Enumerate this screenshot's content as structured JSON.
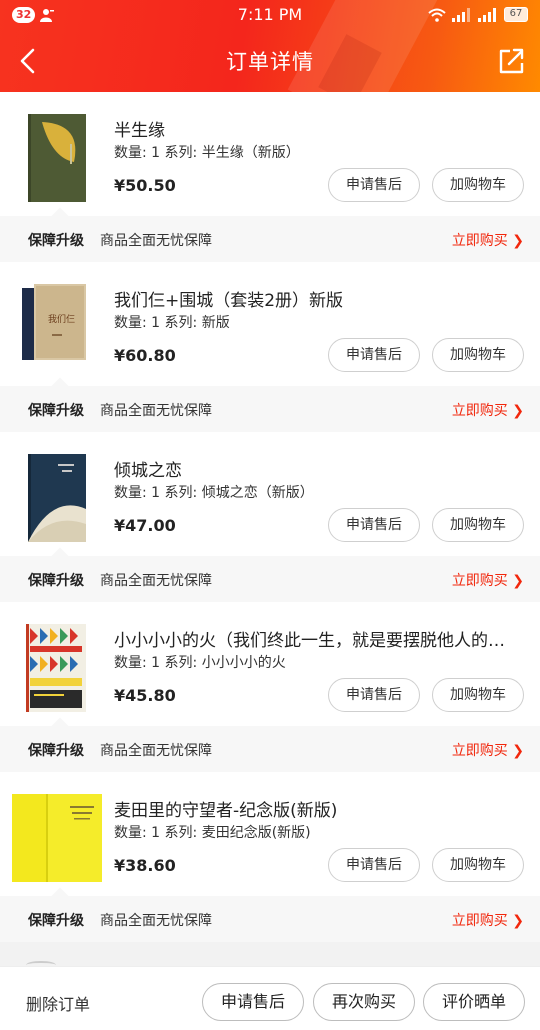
{
  "status_bar": {
    "notification_count": "32",
    "time": "7:11 PM",
    "battery": "67"
  },
  "nav": {
    "title": "订单详情",
    "back_icon": "chevron-left-icon",
    "share_icon": "share-icon"
  },
  "items": [
    {
      "title": "半生缘",
      "meta": "数量: 1 系列: 半生缘（新版）",
      "price": "¥50.50",
      "after_sale_label": "申请售后",
      "cart_label": "加购物车",
      "guard_label": "保障升级",
      "guard_text": "商品全面无忧保障",
      "guard_link": "立即购买 ❯"
    },
    {
      "title": "我们仨+围城（套装2册）新版",
      "meta": "数量: 1 系列: 新版",
      "price": "¥60.80",
      "after_sale_label": "申请售后",
      "cart_label": "加购物车",
      "guard_label": "保障升级",
      "guard_text": "商品全面无忧保障",
      "guard_link": "立即购买 ❯"
    },
    {
      "title": "倾城之恋",
      "meta": "数量: 1 系列: 倾城之恋（新版）",
      "price": "¥47.00",
      "after_sale_label": "申请售后",
      "cart_label": "加购物车",
      "guard_label": "保障升级",
      "guard_text": "商品全面无忧保障",
      "guard_link": "立即购买 ❯"
    },
    {
      "title": "小小小小的火（我们终此一生，就是要摆脱他人的…",
      "meta": "数量: 1 系列: 小小小小的火",
      "price": "¥45.80",
      "after_sale_label": "申请售后",
      "cart_label": "加购物车",
      "guard_label": "保障升级",
      "guard_text": "商品全面无忧保障",
      "guard_link": "立即购买 ❯"
    },
    {
      "title": "麦田里的守望者-纪念版(新版)",
      "meta": "数量: 1 系列: 麦田纪念版(新版)",
      "price": "¥38.60",
      "after_sale_label": "申请售后",
      "cart_label": "加购物车",
      "guard_label": "保障升级",
      "guard_text": "商品全面无忧保障",
      "guard_link": "立即购买 ❯"
    }
  ],
  "bottom_bar": {
    "delete_label": "删除订单",
    "after_sale_label": "申请售后",
    "rebuy_label": "再次购买",
    "review_label": "评价晒单"
  },
  "colors": {
    "brand_red": "#f4261c",
    "link_red": "#f2270c"
  }
}
